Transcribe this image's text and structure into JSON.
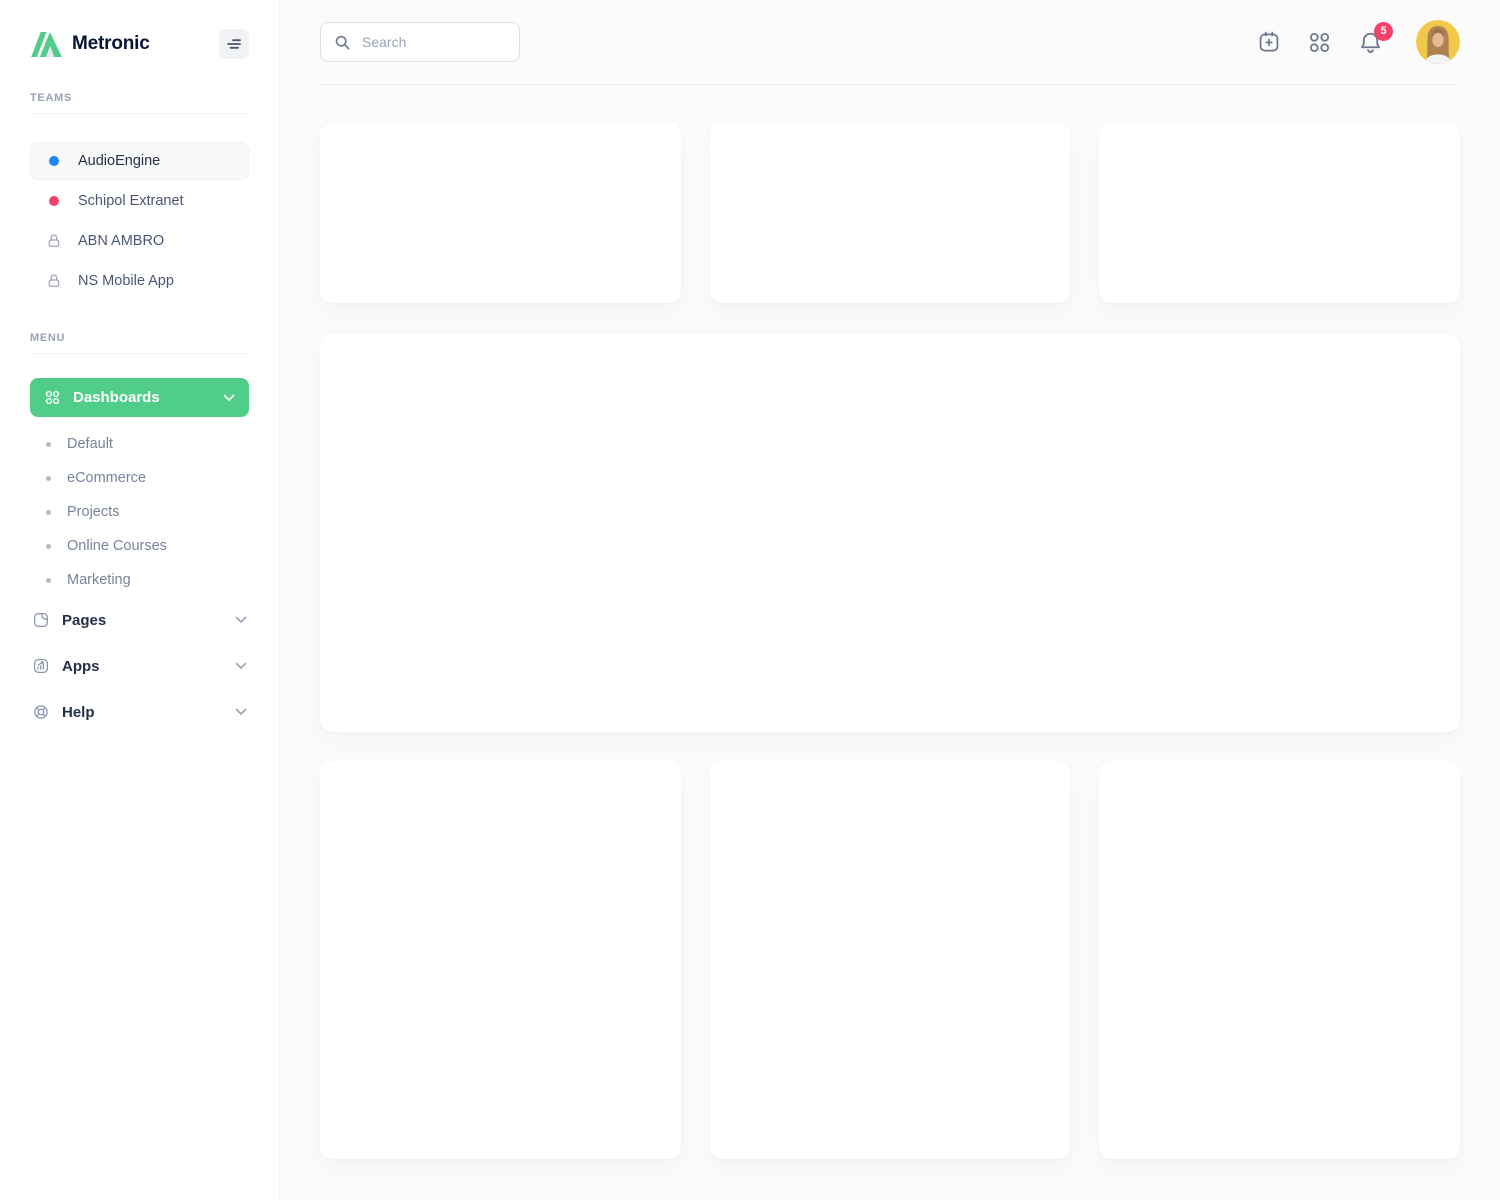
{
  "app": {
    "brand": "Metronic"
  },
  "colors": {
    "green": "#50cd89",
    "blue": "#1b84ff",
    "pink": "#f1416c",
    "avatar_yellow": "#f2c84b"
  },
  "sidebar": {
    "teams_label": "TEAMS",
    "menu_label": "MENU",
    "teams": [
      {
        "label": "AudioEngine",
        "indicator": "blue-dot"
      },
      {
        "label": "Schipol Extranet",
        "indicator": "pink-dot"
      },
      {
        "label": "ABN AMBRO",
        "indicator": "lock"
      },
      {
        "label": "NS Mobile App",
        "indicator": "lock"
      }
    ],
    "dashboards": {
      "label": "Dashboards",
      "items": [
        {
          "label": "Default"
        },
        {
          "label": "eCommerce"
        },
        {
          "label": "Projects"
        },
        {
          "label": "Online Courses"
        },
        {
          "label": "Marketing"
        }
      ]
    },
    "menu_items": [
      {
        "label": "Pages",
        "icon": "page-icon"
      },
      {
        "label": "Apps",
        "icon": "chart-icon"
      },
      {
        "label": "Help",
        "icon": "lifebuoy-icon"
      }
    ]
  },
  "header": {
    "search_placeholder": "Search",
    "notification_count": "5"
  }
}
